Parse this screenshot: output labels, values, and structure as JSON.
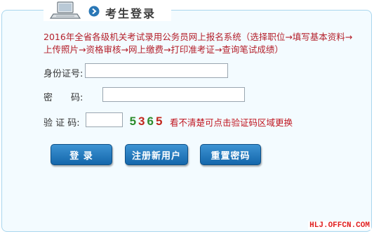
{
  "header": {
    "title": "考生登录",
    "icon": "laptop-icon",
    "arrow_icon": "circle-arrow-right-icon"
  },
  "intro_text": "2016年全省各级机关考试录用公务员网上报名系统（选择职位→填写基本资料→上传照片→资格审核→网上缴费→打印准考证→查询笔试成绩）",
  "form": {
    "id_label": "身份证号:",
    "id_value": "",
    "password_label": "密　　码:",
    "password_value": "",
    "captcha_label": "验 证 码:",
    "captcha_value": "",
    "captcha_digits": [
      {
        "char": "5",
        "color": "#2c8c2c"
      },
      {
        "char": "3",
        "color": "#c2281f"
      },
      {
        "char": "6",
        "color": "#2c8c2c"
      },
      {
        "char": "5",
        "color": "#c2281f"
      }
    ],
    "captcha_tip": "看不清楚可点击验证码区域更换"
  },
  "buttons": {
    "login": "登  录",
    "register": "注册新用户",
    "reset": "重置密码"
  },
  "watermark": "HLJ.OFFCN.COM",
  "colors": {
    "accent_border": "#a9d6ee",
    "intro_text": "#b4202b",
    "button": "#1e6fb3"
  }
}
